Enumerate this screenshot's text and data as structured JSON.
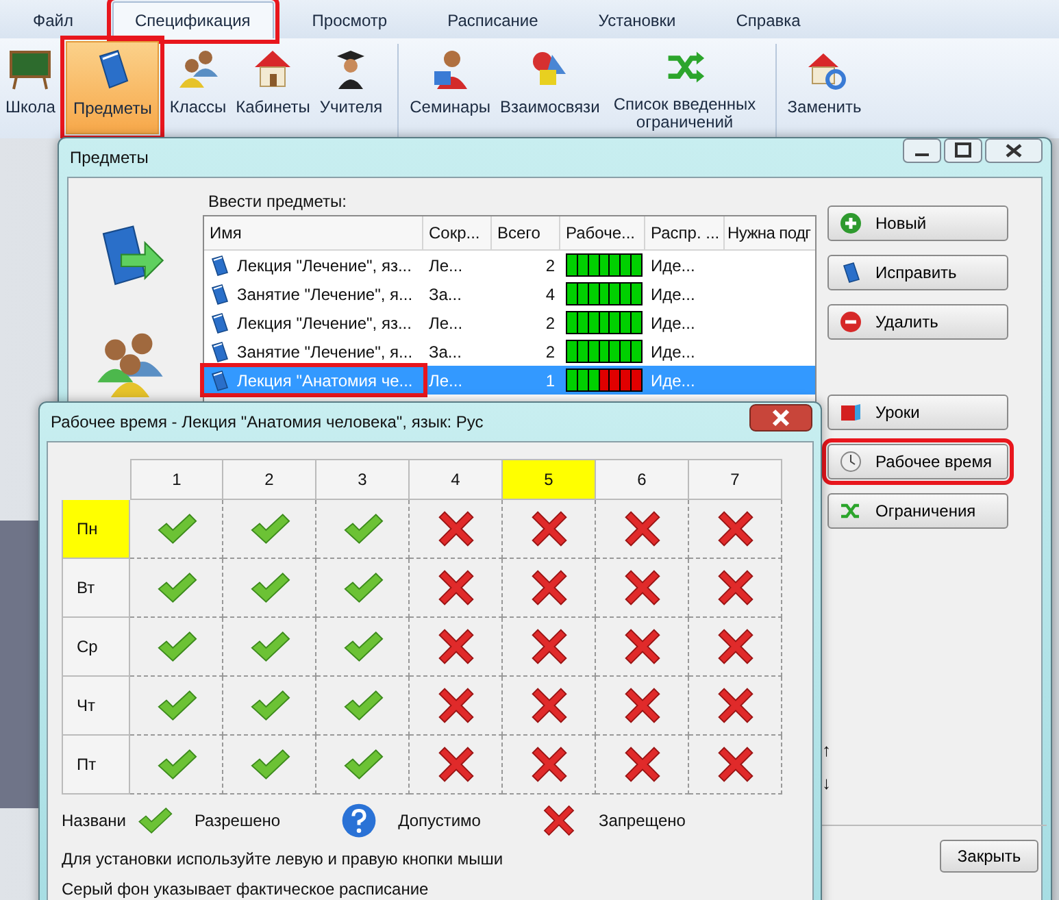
{
  "menu": {
    "tabs": [
      {
        "label": "Файл",
        "selected": false,
        "annotated": false
      },
      {
        "label": "Спецификация",
        "selected": true,
        "annotated": true
      },
      {
        "label": "Просмотр",
        "selected": false,
        "annotated": false
      },
      {
        "label": "Расписание",
        "selected": false,
        "annotated": false
      },
      {
        "label": "Установки",
        "selected": false,
        "annotated": false
      },
      {
        "label": "Справка",
        "selected": false,
        "annotated": false
      }
    ]
  },
  "ribbon": {
    "groups": [
      [
        {
          "label": "Школа",
          "kind": "school",
          "selected": false,
          "annotated": false
        },
        {
          "label": "Предметы",
          "kind": "book",
          "selected": true,
          "annotated": true
        },
        {
          "label": "Классы",
          "kind": "people",
          "selected": false,
          "annotated": false
        },
        {
          "label": "Кабинеты",
          "kind": "house",
          "selected": false,
          "annotated": false
        },
        {
          "label": "Учителя",
          "kind": "teacher",
          "selected": false,
          "annotated": false
        }
      ],
      [
        {
          "label": "Семинары",
          "kind": "seminar",
          "selected": false,
          "annotated": false
        },
        {
          "label": "Взаимосвязи",
          "kind": "shapes",
          "selected": false,
          "annotated": false
        },
        {
          "label": "Список введенных ограничений",
          "kind": "shuffle",
          "selected": false,
          "annotated": false
        }
      ],
      [
        {
          "label": "Заменить",
          "kind": "replace",
          "selected": false,
          "annotated": false
        }
      ]
    ]
  },
  "subjects_window": {
    "title": "Предметы",
    "label": "Ввести предметы:",
    "columns": [
      "Имя",
      "Сокр...",
      "Всего",
      "Рабоче...",
      "Распр. ...",
      "Нужна подг"
    ],
    "rows": [
      {
        "name": "Лекция \"Лечение\", яз...",
        "abbr": "Ле...",
        "total": "2",
        "work": [
          true,
          true,
          true,
          true,
          true,
          true,
          true
        ],
        "distribution": "Иде...",
        "selected": false,
        "annotated": false
      },
      {
        "name": "Занятие \"Лечение\", я...",
        "abbr": "За...",
        "total": "4",
        "work": [
          true,
          true,
          true,
          true,
          true,
          true,
          true
        ],
        "distribution": "Иде...",
        "selected": false,
        "annotated": false
      },
      {
        "name": "Лекция \"Лечение\", яз...",
        "abbr": "Ле...",
        "total": "2",
        "work": [
          true,
          true,
          true,
          true,
          true,
          true,
          true
        ],
        "distribution": "Иде...",
        "selected": false,
        "annotated": false
      },
      {
        "name": "Занятие \"Лечение\", я...",
        "abbr": "За...",
        "total": "2",
        "work": [
          true,
          true,
          true,
          true,
          true,
          true,
          true
        ],
        "distribution": "Иде...",
        "selected": false,
        "annotated": false
      },
      {
        "name": "Лекция \"Анатомия че...",
        "abbr": "Ле...",
        "total": "1",
        "work": [
          true,
          true,
          true,
          false,
          false,
          false,
          false
        ],
        "distribution": "Иде...",
        "selected": true,
        "annotated": true
      }
    ],
    "buttons": [
      {
        "label": "Новый",
        "kind": "plus",
        "annotated": false
      },
      {
        "label": "Исправить",
        "kind": "book",
        "annotated": false
      },
      {
        "label": "Удалить",
        "kind": "minus",
        "annotated": false
      }
    ],
    "buttons_lower": [
      {
        "label": "Уроки",
        "kind": "lessons",
        "annotated": false
      },
      {
        "label": "Рабочее время",
        "kind": "clock",
        "annotated": true
      },
      {
        "label": "Ограничения",
        "kind": "shuffle",
        "annotated": false
      }
    ],
    "arrows": [
      "↑",
      "↓"
    ],
    "close_button": "Закрыть"
  },
  "work_dialog": {
    "title": "Рабочее время - Лекция \"Анатомия человека\", язык: Рус",
    "columns": [
      {
        "label": "1",
        "selected": false
      },
      {
        "label": "2",
        "selected": false
      },
      {
        "label": "3",
        "selected": false
      },
      {
        "label": "4",
        "selected": false
      },
      {
        "label": "5",
        "selected": true
      },
      {
        "label": "6",
        "selected": false
      },
      {
        "label": "7",
        "selected": false
      }
    ],
    "rows": [
      {
        "day": "Пн",
        "selected": true,
        "cells": [
          {
            "kind": "allowed"
          },
          {
            "kind": "allowed"
          },
          {
            "kind": "allowed"
          },
          {
            "kind": "forbidden"
          },
          {
            "kind": "forbidden"
          },
          {
            "kind": "forbidden"
          },
          {
            "kind": "forbidden"
          }
        ]
      },
      {
        "day": "Вт",
        "selected": false,
        "cells": [
          {
            "kind": "allowed"
          },
          {
            "kind": "allowed"
          },
          {
            "kind": "allowed"
          },
          {
            "kind": "forbidden"
          },
          {
            "kind": "forbidden"
          },
          {
            "kind": "forbidden"
          },
          {
            "kind": "forbidden"
          }
        ]
      },
      {
        "day": "Ср",
        "selected": false,
        "cells": [
          {
            "kind": "allowed"
          },
          {
            "kind": "allowed"
          },
          {
            "kind": "allowed"
          },
          {
            "kind": "forbidden"
          },
          {
            "kind": "forbidden"
          },
          {
            "kind": "forbidden"
          },
          {
            "kind": "forbidden"
          }
        ]
      },
      {
        "day": "Чт",
        "selected": false,
        "cells": [
          {
            "kind": "allowed"
          },
          {
            "kind": "allowed"
          },
          {
            "kind": "allowed"
          },
          {
            "kind": "forbidden"
          },
          {
            "kind": "forbidden"
          },
          {
            "kind": "forbidden"
          },
          {
            "kind": "forbidden"
          }
        ]
      },
      {
        "day": "Пт",
        "selected": false,
        "cells": [
          {
            "kind": "allowed"
          },
          {
            "kind": "allowed"
          },
          {
            "kind": "allowed"
          },
          {
            "kind": "forbidden"
          },
          {
            "kind": "forbidden"
          },
          {
            "kind": "forbidden"
          },
          {
            "kind": "forbidden"
          }
        ]
      }
    ],
    "legend": {
      "caption": "Названи",
      "items": [
        {
          "kind": "allowed",
          "label": "Разрешено"
        },
        {
          "kind": "possible",
          "label": "Допустимо"
        },
        {
          "kind": "forbidden",
          "label": "Запрещено"
        }
      ]
    },
    "notes": [
      "Для установки используйте левую и правую кнопки мыши",
      "Серый фон указывает фактическое расписание"
    ]
  }
}
